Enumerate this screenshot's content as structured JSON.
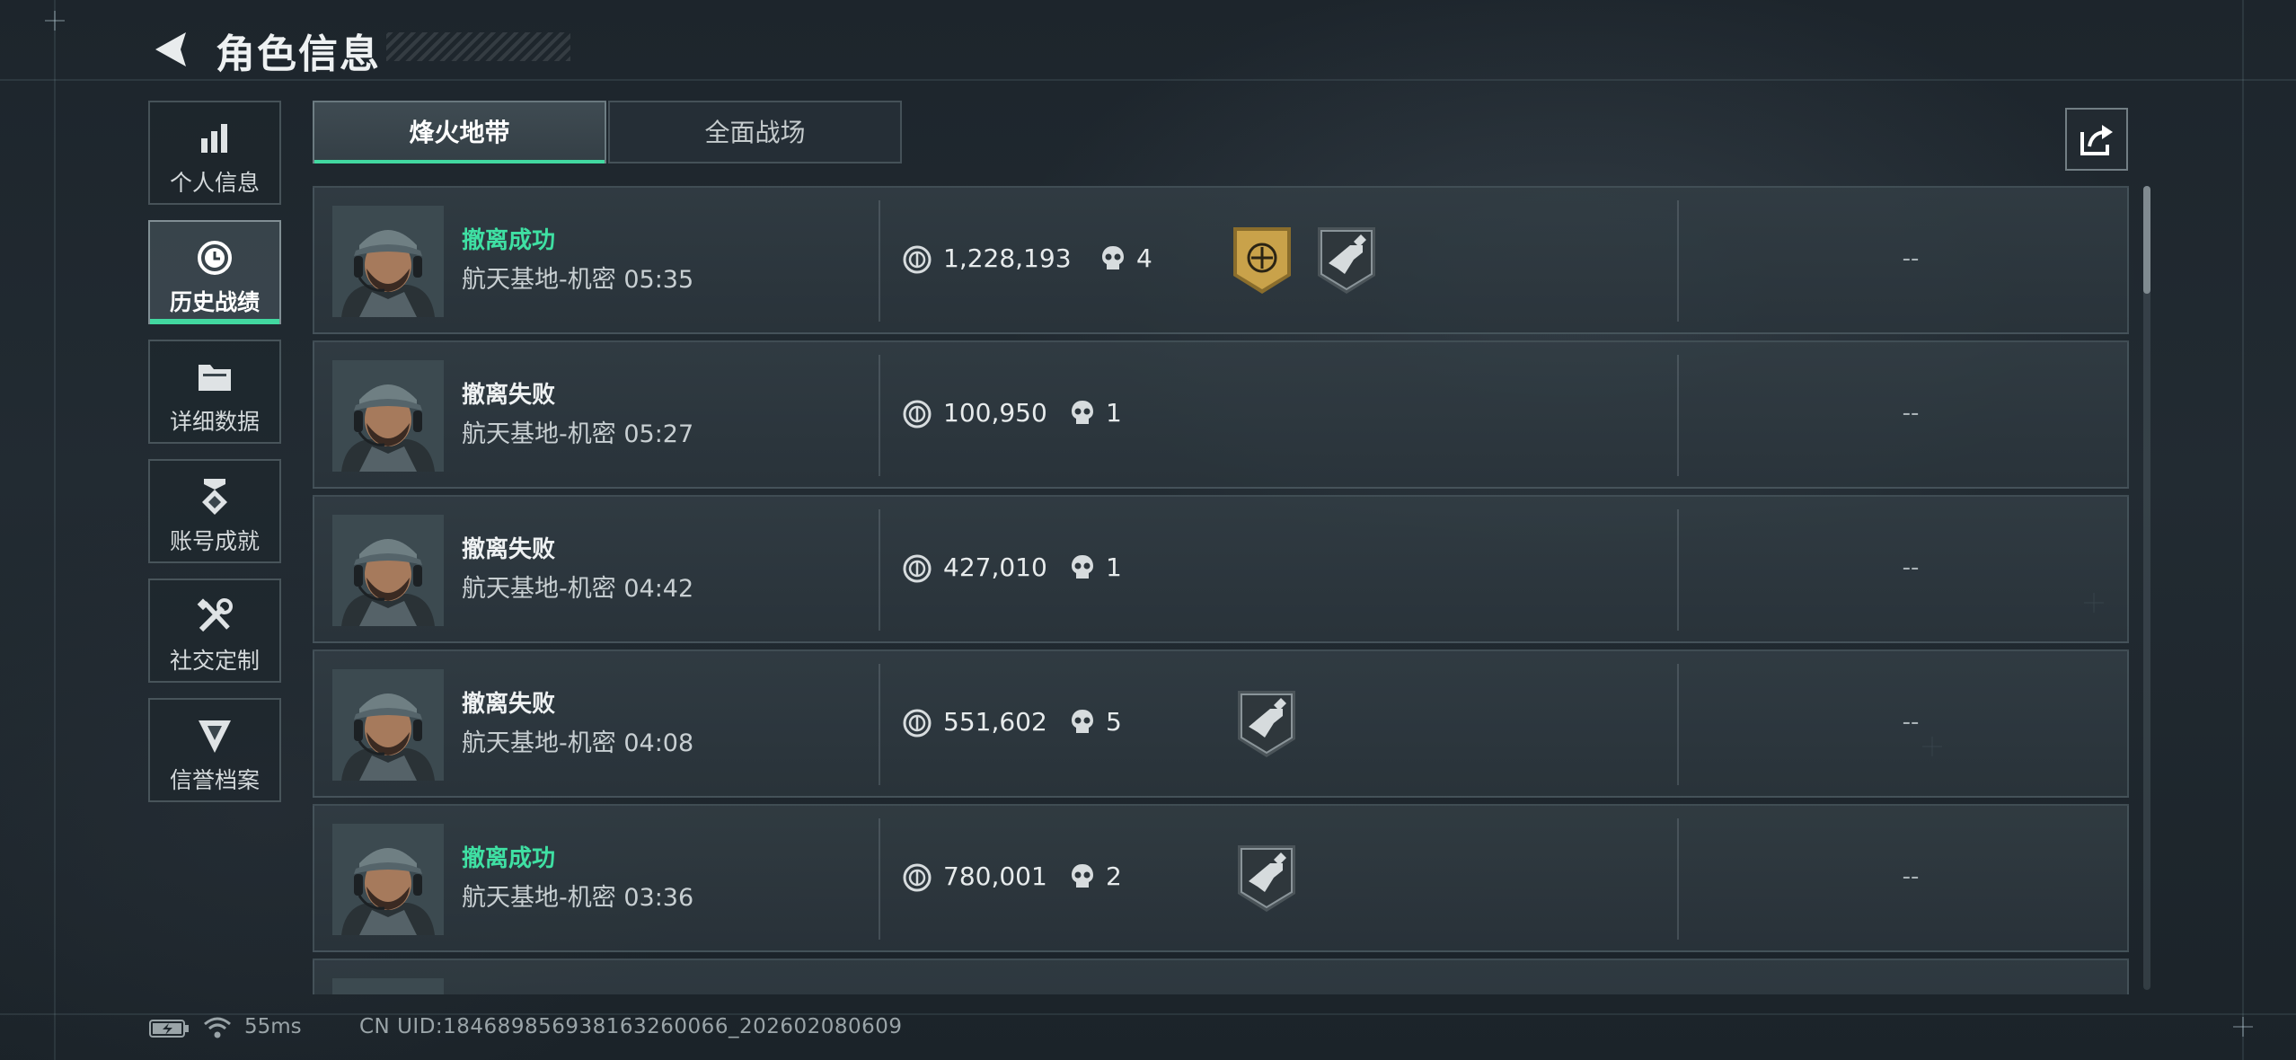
{
  "header": {
    "title": "角色信息",
    "back_icon": "back-chevron-icon"
  },
  "sidebar": {
    "items": [
      {
        "label": "个人信息",
        "icon": "bar-chart-icon",
        "active": false
      },
      {
        "label": "历史战绩",
        "icon": "clock-history-icon",
        "active": true
      },
      {
        "label": "详细数据",
        "icon": "folder-icon",
        "active": false
      },
      {
        "label": "账号成就",
        "icon": "medal-icon",
        "active": false
      },
      {
        "label": "社交定制",
        "icon": "tools-icon",
        "active": false
      },
      {
        "label": "信誉档案",
        "icon": "shield-emblem-icon",
        "active": false
      }
    ]
  },
  "tabs": [
    {
      "label": "烽火地带",
      "active": true
    },
    {
      "label": "全面战场",
      "active": false
    }
  ],
  "share_icon": "share-export-icon",
  "matches": [
    {
      "status": "撤离成功",
      "success": true,
      "map": "航天基地-机密",
      "duration": "05:35",
      "value": "1,228,193",
      "kills": "4",
      "badges": [
        "gold-emblem-badge",
        "grey-gun-badge"
      ],
      "extra": "--"
    },
    {
      "status": "撤离失败",
      "success": false,
      "map": "航天基地-机密",
      "duration": "05:27",
      "value": "100,950",
      "kills": "1",
      "badges": [],
      "extra": "--"
    },
    {
      "status": "撤离失败",
      "success": false,
      "map": "航天基地-机密",
      "duration": "04:42",
      "value": "427,010",
      "kills": "1",
      "badges": [],
      "extra": "--"
    },
    {
      "status": "撤离失败",
      "success": false,
      "map": "航天基地-机密",
      "duration": "04:08",
      "value": "551,602",
      "kills": "5",
      "badges": [
        "grey-gun-badge"
      ],
      "extra": "--"
    },
    {
      "status": "撤离成功",
      "success": true,
      "map": "航天基地-机密",
      "duration": "03:36",
      "value": "780,001",
      "kills": "2",
      "badges": [
        "grey-gun-badge"
      ],
      "extra": "--"
    }
  ],
  "colors": {
    "accent": "#42d8a0",
    "success_text": "#3fe0a3",
    "badge_gold": "#c9a24a"
  },
  "status_bar": {
    "battery_icon": "battery-charging-icon",
    "wifi_icon": "wifi-icon",
    "ping": "55ms",
    "uid": "CN UID:1846898569381632600​66_202602080609"
  }
}
